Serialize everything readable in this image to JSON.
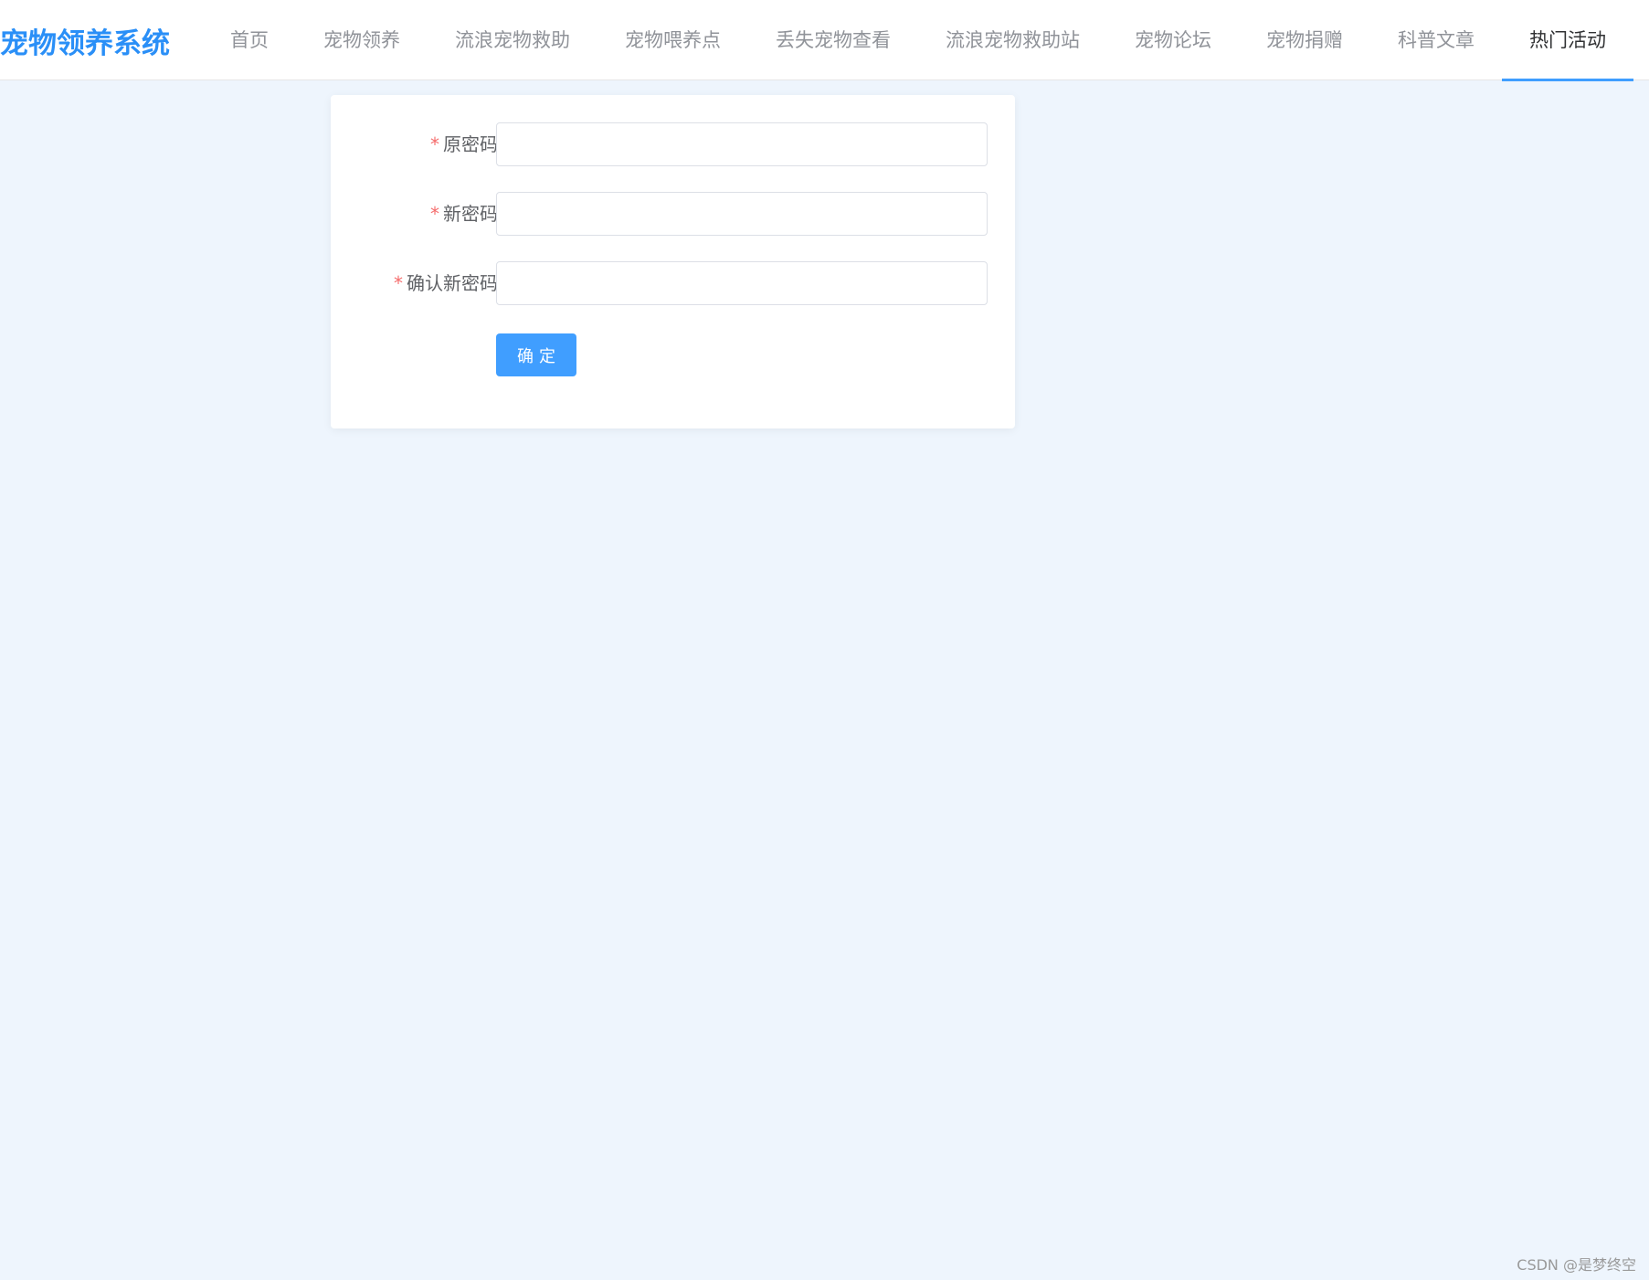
{
  "header": {
    "logo": "宠物领养系统",
    "nav": [
      {
        "label": "首页",
        "active": false
      },
      {
        "label": "宠物领养",
        "active": false
      },
      {
        "label": "流浪宠物救助",
        "active": false
      },
      {
        "label": "宠物喂养点",
        "active": false
      },
      {
        "label": "丢失宠物查看",
        "active": false
      },
      {
        "label": "流浪宠物救助站",
        "active": false
      },
      {
        "label": "宠物论坛",
        "active": false
      },
      {
        "label": "宠物捐赠",
        "active": false
      },
      {
        "label": "科普文章",
        "active": false
      },
      {
        "label": "热门活动",
        "active": true
      }
    ]
  },
  "form": {
    "required_mark": "*",
    "fields": [
      {
        "label": "原密码",
        "value": "",
        "placeholder": ""
      },
      {
        "label": "新密码",
        "value": "",
        "placeholder": ""
      },
      {
        "label": "确认新密码",
        "value": "",
        "placeholder": ""
      }
    ],
    "submit_label": "确定"
  },
  "watermark": "CSDN @是梦终空",
  "colors": {
    "accent": "#409eff",
    "logo": "#2a8ff7",
    "background": "#eef5fd",
    "required": "#f56c6c"
  }
}
